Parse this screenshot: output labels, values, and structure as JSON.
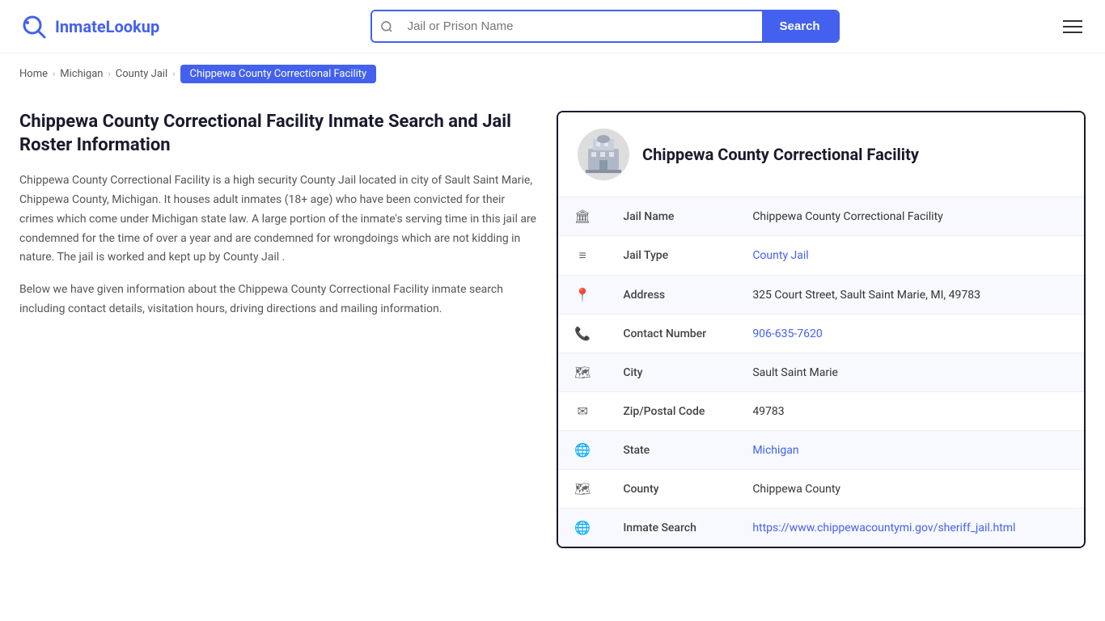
{
  "header": {
    "logo_text_part1": "Inmate",
    "logo_text_part2": "Lookup",
    "search_placeholder": "Jail or Prison Name",
    "search_button_label": "Search"
  },
  "breadcrumb": {
    "home_label": "Home",
    "michigan_label": "Michigan",
    "county_jail_label": "County Jail",
    "current_label": "Chippewa County Correctional Facility"
  },
  "left_col": {
    "heading": "Chippewa County Correctional Facility Inmate Search and Jail Roster Information",
    "description1": "Chippewa County Correctional Facility is a high security County Jail located in city of Sault Saint Marie, Chippewa County, Michigan. It houses adult inmates (18+ age) who have been convicted for their crimes which come under Michigan state law. A large portion of the inmate's serving time in this jail are condemned for the time of over a year and are condemned for wrongdoings which are not kidding in nature. The jail is worked and kept up by County Jail .",
    "description2": "Below we have given information about the Chippewa County Correctional Facility inmate search including contact details, visitation hours, driving directions and mailing information."
  },
  "facility": {
    "name": "Chippewa County Correctional Facility",
    "rows": [
      {
        "icon": "🏛",
        "label": "Jail Name",
        "value": "Chippewa County Correctional Facility",
        "link": null
      },
      {
        "icon": "≡",
        "label": "Jail Type",
        "value": "County Jail",
        "link": "#"
      },
      {
        "icon": "📍",
        "label": "Address",
        "value": "325 Court Street, Sault Saint Marie, MI, 49783",
        "link": null
      },
      {
        "icon": "📞",
        "label": "Contact Number",
        "value": "906-635-7620",
        "link": "tel:906-635-7620"
      },
      {
        "icon": "🗺",
        "label": "City",
        "value": "Sault Saint Marie",
        "link": null
      },
      {
        "icon": "✉",
        "label": "Zip/Postal Code",
        "value": "49783",
        "link": null
      },
      {
        "icon": "🌐",
        "label": "State",
        "value": "Michigan",
        "link": "#"
      },
      {
        "icon": "🗺",
        "label": "County",
        "value": "Chippewa County",
        "link": null
      },
      {
        "icon": "🌐",
        "label": "Inmate Search",
        "value": "https://www.chippewacountymi.gov/sheriff_jail.html",
        "link": "https://www.chippewacountymi.gov/sheriff_jail.html"
      }
    ]
  }
}
